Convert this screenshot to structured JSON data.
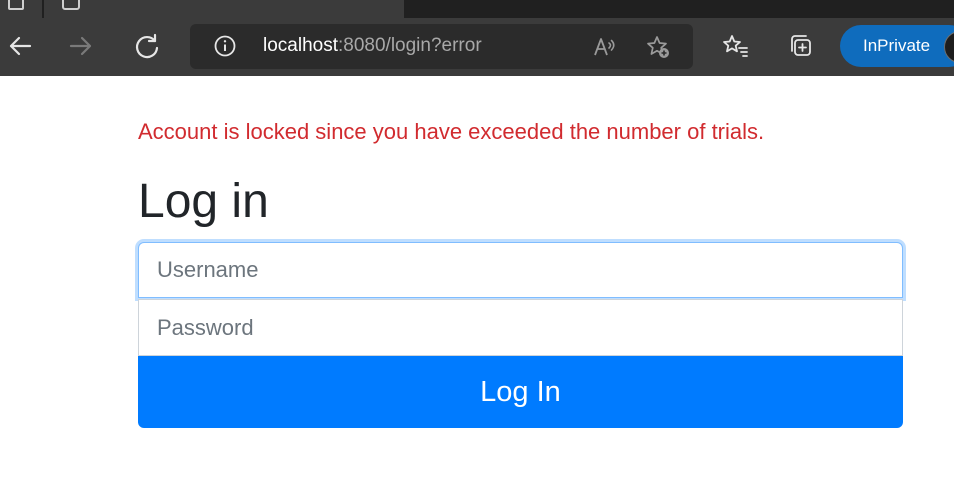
{
  "browser": {
    "address": {
      "host": "localhost",
      "rest": ":8080/login?error"
    },
    "inprivate_label": "InPrivate"
  },
  "page": {
    "error_message": "Account is locked since you have exceeded the number of trials.",
    "title": "Log in",
    "username_placeholder": "Username",
    "password_placeholder": "Password",
    "submit_label": "Log In"
  },
  "colors": {
    "error": "#d12b2f",
    "primary": "#007bff",
    "inprivate": "#0f6cbd"
  }
}
